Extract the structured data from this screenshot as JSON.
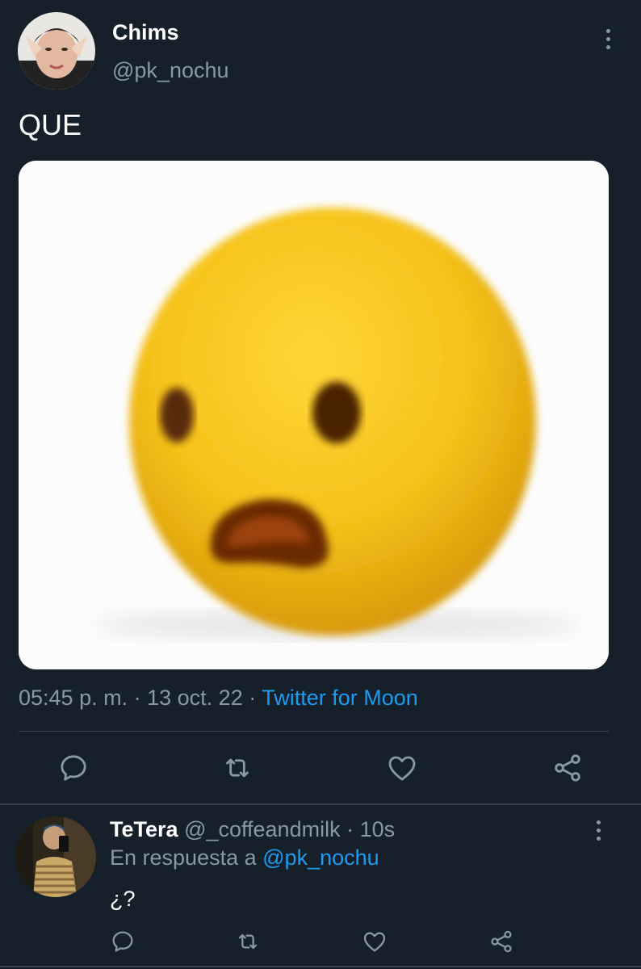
{
  "tweet": {
    "author_name": "Chims",
    "author_handle": "@pk_nochu",
    "text": "QUE",
    "time": "05:45 p. m.",
    "date": "13 oct. 22",
    "source": "Twitter for Moon",
    "separator": "·",
    "media_alt": "frightened-face-emoji-image",
    "avatar": "user-avatar-photo",
    "more_icon": "kebab-menu-icon"
  },
  "actions": [
    {
      "name": "reply",
      "icon": "reply-icon"
    },
    {
      "name": "retweet",
      "icon": "retweet-icon"
    },
    {
      "name": "like",
      "icon": "heart-icon"
    },
    {
      "name": "share",
      "icon": "share-icon"
    }
  ],
  "reply": {
    "author_name": "TeTera",
    "author_handle": "@_coffeandmilk",
    "time_ago": "10s",
    "separator": "·",
    "in_reply_prefix": "En respuesta a",
    "in_reply_handle": "@pk_nochu",
    "text": "¿?",
    "avatar": "reply-avatar-photo"
  },
  "colors": {
    "background": "#15202b",
    "muted": "#8899a6",
    "link": "#1d9bf0",
    "divider": "#38444d"
  }
}
